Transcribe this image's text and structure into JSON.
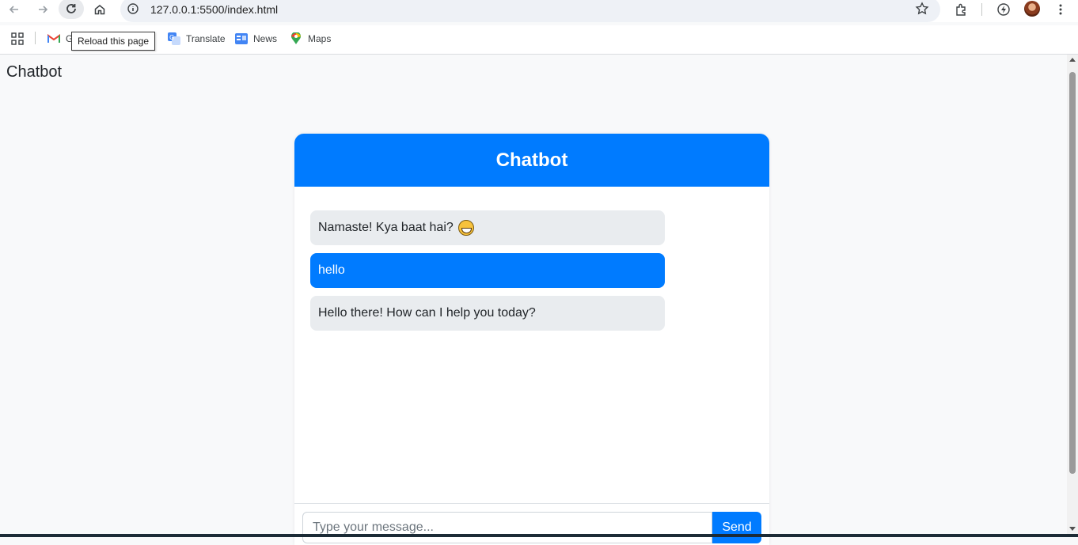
{
  "browser": {
    "url": "127.0.0.1:5500/index.html",
    "tooltip": "Reload this page",
    "bookmarks": [
      {
        "label": "G",
        "icon": "gmail-icon"
      },
      {
        "label": "Translate",
        "icon": "google-translate-icon"
      },
      {
        "label": "News",
        "icon": "google-news-icon"
      },
      {
        "label": "Maps",
        "icon": "google-maps-icon"
      }
    ]
  },
  "page": {
    "heading": "Chatbot"
  },
  "chat": {
    "title": "Chatbot",
    "messages": [
      {
        "sender": "bot",
        "text": "Namaste! Kya baat hai?",
        "emoji": "grinning-face"
      },
      {
        "sender": "user",
        "text": "hello"
      },
      {
        "sender": "bot",
        "text": "Hello there! How can I help you today?"
      }
    ],
    "input_placeholder": "Type your message...",
    "send_label": "Send"
  },
  "colors": {
    "accent": "#007bff",
    "bot_bubble": "#e9ecef",
    "page_bg": "#f8f9fa"
  }
}
